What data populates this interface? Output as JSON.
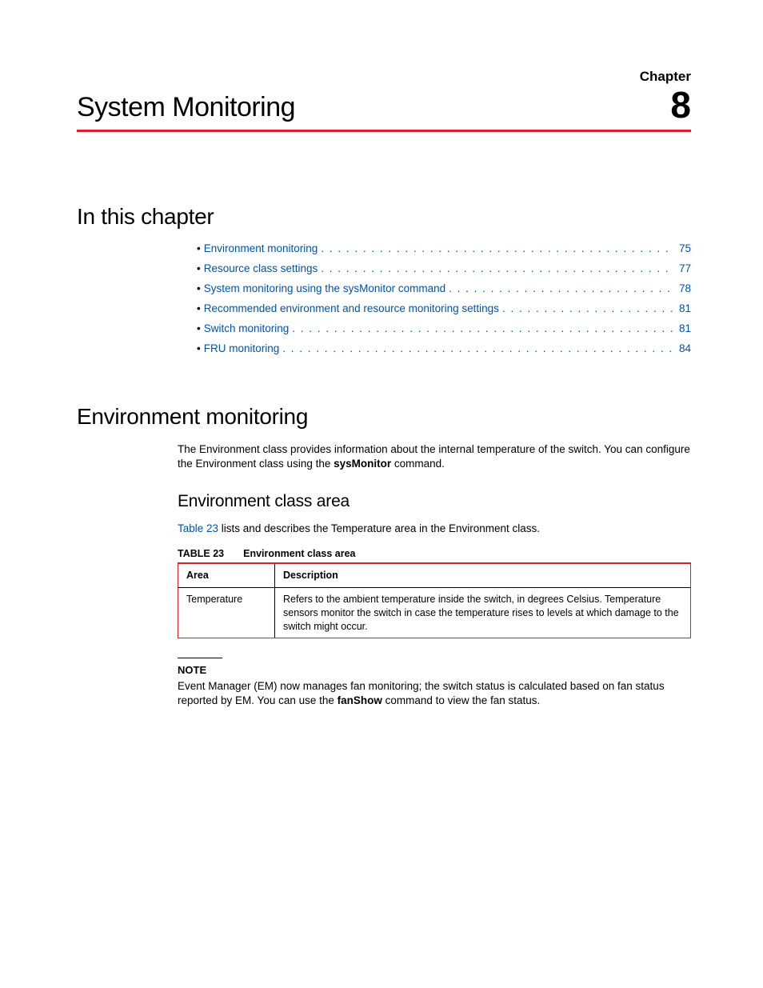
{
  "chapter": {
    "title": "System Monitoring",
    "label": "Chapter",
    "number": "8"
  },
  "sections": {
    "in_this_chapter": "In this chapter",
    "environment_monitoring": "Environment monitoring",
    "environment_class_area": "Environment class area"
  },
  "toc": [
    {
      "label": "Environment monitoring",
      "page": "75"
    },
    {
      "label": "Resource class settings",
      "page": "77"
    },
    {
      "label": "System monitoring using the sysMonitor command",
      "page": "78"
    },
    {
      "label": "Recommended environment and resource monitoring settings",
      "page": "81"
    },
    {
      "label": "Switch monitoring",
      "page": "81"
    },
    {
      "label": "FRU monitoring",
      "page": "84"
    }
  ],
  "env_intro": {
    "pre": "The Environment class provides information about the internal temperature of the switch. You can configure the Environment class using the ",
    "cmd": "sysMonitor",
    "post": " command."
  },
  "env_class_para": {
    "link": "Table 23",
    "rest": " lists and describes the Temperature area in the Environment class."
  },
  "table23": {
    "caption_label": "TABLE 23",
    "caption_title": "Environment class area",
    "headers": {
      "area": "Area",
      "description": "Description"
    },
    "row": {
      "area": "Temperature",
      "description": "Refers to the ambient temperature inside the switch, in degrees Celsius. Temperature sensors monitor the switch in case the temperature rises to levels at which damage to the switch might occur."
    }
  },
  "note": {
    "label": "NOTE",
    "pre": "Event Manager (EM) now manages fan monitoring; the switch status is calculated based on fan status reported by EM. You can use the ",
    "cmd": "fanShow",
    "post": " command to view the fan status."
  }
}
